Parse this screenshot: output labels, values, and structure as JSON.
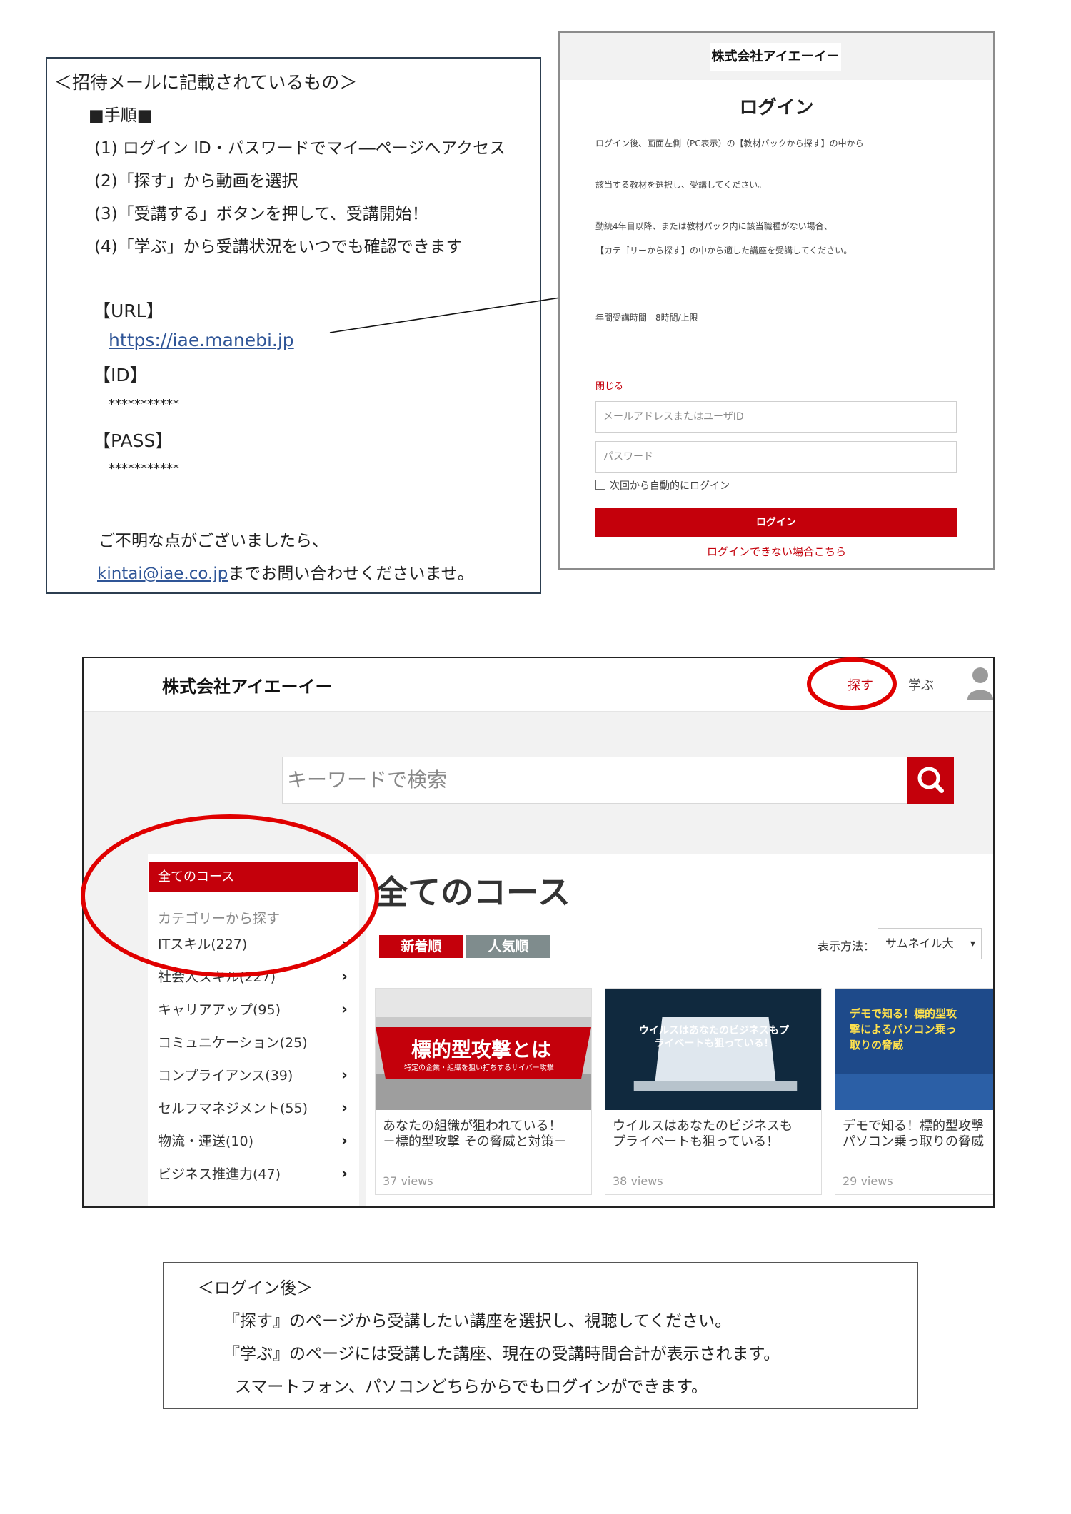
{
  "invite": {
    "heading": "＜招待メールに記載されているもの＞",
    "steps_title": "■手順■",
    "steps": [
      "(1) ログイン ID・パスワードでマイ―ページへアクセス",
      "(2)「探す」から動画を選択",
      "(3)「受講する」ボタンを押して、受講開始！",
      "(4)「学ぶ」から受講状況をいつでも確認できます"
    ],
    "url_label": "【URL】",
    "url": "https://iae.manebi.jp",
    "id_label": "【ID】",
    "id_value": "***********",
    "pass_label": "【PASS】",
    "pass_value": "***********",
    "contact_line1": "ご不明な点がございましたら、",
    "contact_email": "kintai@iae.co.jp",
    "contact_line2": "までお問い合わせくださいませ。"
  },
  "login": {
    "logo": "株式会社アイエーイー",
    "title": "ログイン",
    "notes": [
      "ログイン後、画面左側（PC表示）の【教材パックから探す】の中から",
      "該当する教材を選択し、受講してください。",
      "勤続4年目以降、または教材パック内に該当職種がない場合、",
      "【カテゴリーから探す】の中から適した講座を受講してください。",
      "年間受講時間　8時間/上限"
    ],
    "close": "閉じる",
    "email_placeholder": "メールアドレスまたはユーザID",
    "password_placeholder": "パスワード",
    "remember": "次回から自動的にログイン",
    "button": "ログイン",
    "cant_login": "ログインできない場合こちら"
  },
  "browse": {
    "brand": "株式会社アイエーイー",
    "nav": {
      "find": "探す",
      "learn": "学ぶ"
    },
    "search_placeholder": "キーワードで検索",
    "sidebar": {
      "all": "全てのコース",
      "category_heading": "カテゴリーから探す",
      "items": [
        {
          "label": "ITスキル(227)",
          "chevron": true
        },
        {
          "label": "社会人スキル(227)",
          "chevron": true
        },
        {
          "label": "キャリアアップ(95)",
          "chevron": true
        },
        {
          "label": "コミュニケーション(25)",
          "chevron": false
        },
        {
          "label": "コンプライアンス(39)",
          "chevron": true
        },
        {
          "label": "セルフマネジメント(55)",
          "chevron": true
        },
        {
          "label": "物流・運送(10)",
          "chevron": true
        },
        {
          "label": "ビジネス推進力(47)",
          "chevron": true
        }
      ]
    },
    "main": {
      "heading": "全てのコース",
      "tab_new": "新着順",
      "tab_popular": "人気順",
      "display_label": "表示方法：",
      "display_value": "サムネイル大",
      "cards": [
        {
          "thumb_title": "標的型攻撃とは",
          "thumb_sub": "特定の企業・組織を狙い打ちするサイバー攻撃",
          "title": "あなたの組織が狙われている！\n－標的型攻撃 その脅威と対策－",
          "views": "37 views"
        },
        {
          "thumb_title": "ウイルスはあなたのビジネスもプライベートも狙っている！",
          "thumb_sub": "",
          "title": "ウイルスはあなたのビジネスも\nプライベートも狙っている！",
          "views": "38 views"
        },
        {
          "thumb_title": "デモで知る！標的型攻撃によるパソコン乗っ取りの脅威",
          "thumb_sub": "",
          "title": "デモで知る！標的型攻撃\nパソコン乗っ取りの脅威",
          "views": "29 views"
        }
      ]
    }
  },
  "after": {
    "heading": "＜ログイン後＞",
    "line1": "『探す』のページから受講したい講座を選択し、視聴してください。",
    "line2": "『学ぶ』のページには受講した講座、現在の受講時間合計が表示されます。",
    "line3": "スマートフォン、パソコンどちらからでもログインができます。"
  },
  "colors": {
    "accent_red": "#c4000b",
    "link_blue": "#2f5597",
    "tab_gray": "#7f8c8d"
  }
}
